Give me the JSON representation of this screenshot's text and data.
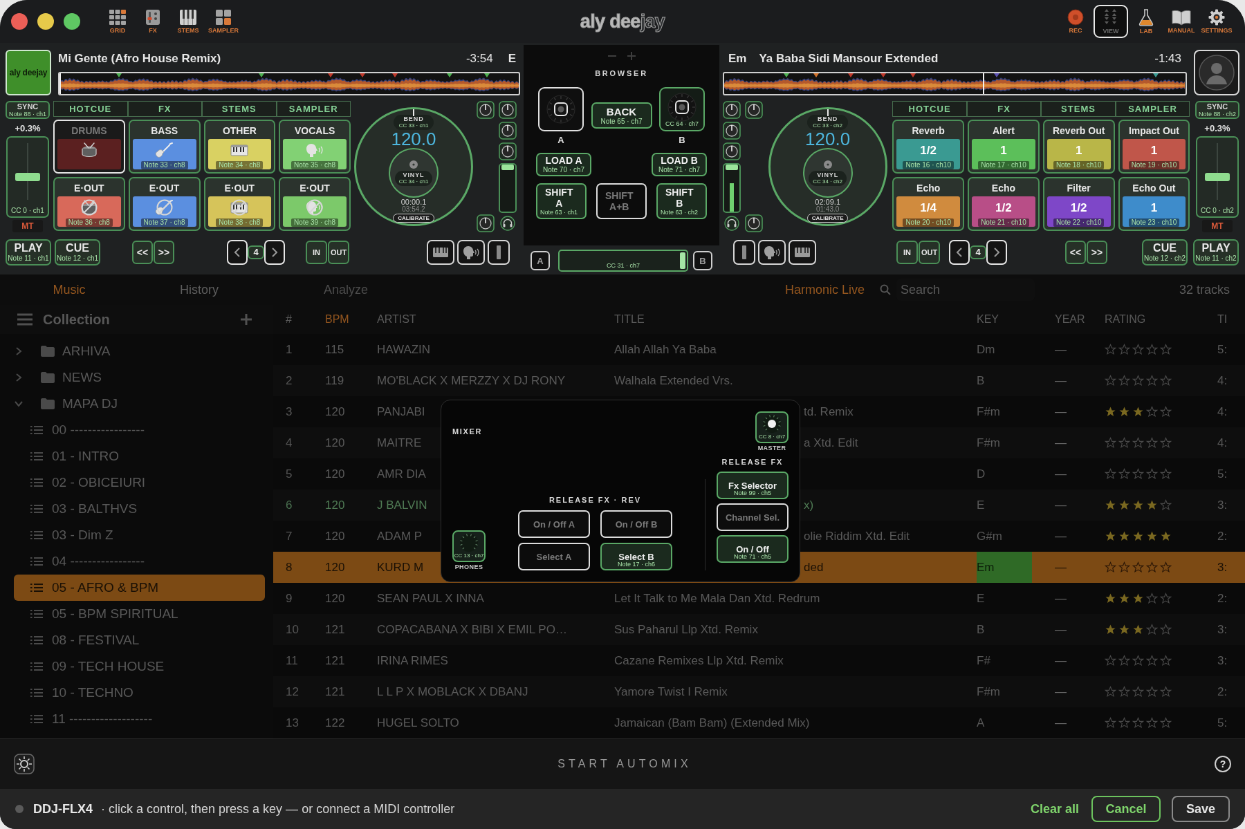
{
  "toolbar_left": [
    {
      "kind": "grid",
      "label": "GRID"
    },
    {
      "kind": "fx",
      "label": "FX"
    },
    {
      "kind": "stems",
      "label": "STEMS"
    },
    {
      "kind": "sampler",
      "label": "SAMPLER"
    }
  ],
  "logo": "**aly dee**jay",
  "toolbar_right": [
    {
      "kind": "rec",
      "label": "REC",
      "selected": false
    },
    {
      "kind": "view",
      "label": "VIEW",
      "selected": true
    },
    {
      "kind": "lab",
      "label": "LAB",
      "selected": false
    },
    {
      "kind": "manual",
      "label": "MANUAL",
      "selected": false
    },
    {
      "kind": "settings",
      "label": "SETTINGS",
      "selected": false
    }
  ],
  "decks": [
    {
      "artwork": {
        "kind": "logo",
        "text": "aly deejay"
      },
      "title": "Mi Gente (Afro House Remix)",
      "remaining": "-3:54",
      "key": "E",
      "playhead": {
        "level": 0
      },
      "sync": {
        "label": "SYNC",
        "note": "Note 88 · ch1"
      },
      "pitch": "+0.3%",
      "pitch_fader": {
        "level": 0.5,
        "note": "CC 0 · ch1"
      },
      "mt": "MT",
      "pad_tabs": [
        "HOTCUE",
        "FX",
        "STEMS",
        "SAMPLER"
      ],
      "pads": [
        {
          "kind": "drums",
          "label": "DRUMS",
          "color": "#5b2020",
          "muted": true,
          "crossed": false
        },
        {
          "kind": "bass",
          "label": "BASS",
          "color": "#5b8fe0",
          "muted": false,
          "crossed": false,
          "note": "Note 33 · ch8"
        },
        {
          "kind": "other",
          "label": "OTHER",
          "color": "#d9d162",
          "muted": false,
          "crossed": false,
          "note": "Note 34 · ch8"
        },
        {
          "kind": "vocals",
          "label": "VOCALS",
          "color": "#82d174",
          "muted": false,
          "crossed": false,
          "note": "Note 35 · ch8"
        },
        {
          "kind": "drums",
          "label": "E·OUT",
          "color": "#d8695a",
          "muted": false,
          "crossed": true,
          "note": "Note 36 · ch8"
        },
        {
          "kind": "bass",
          "label": "E·OUT",
          "color": "#5b8fe0",
          "muted": false,
          "crossed": true,
          "note": "Note 37 · ch8"
        },
        {
          "kind": "other",
          "label": "E·OUT",
          "color": "#d6c45a",
          "muted": false,
          "crossed": true,
          "note": "Note 38 · ch8"
        },
        {
          "kind": "vocals",
          "label": "E·OUT",
          "color": "#7cc96a",
          "muted": false,
          "crossed": true,
          "note": "Note 39 · ch8"
        }
      ],
      "jog": {
        "bend": "BEND",
        "bend_note": "CC 33 · ch1",
        "bpm": "120.0",
        "vinyl": "VINYL",
        "vinyl_note": "CC 34 · ch1",
        "elapsed": "00:00.1",
        "total": "03:54.2",
        "calibrate": "CALIBRATE"
      },
      "volume": {
        "level": 0.95
      },
      "transport": [
        {
          "label": "PLAY",
          "note": "Note 11 · ch1"
        },
        {
          "label": "CUE",
          "note": "Note 12 · ch1"
        }
      ],
      "seek": [
        {
          "label": "<<"
        },
        {
          "label": ">>"
        }
      ],
      "loop": {
        "value": "4"
      },
      "in_out": [
        {
          "label": "IN"
        },
        {
          "label": "OUT"
        }
      ]
    },
    {
      "key": "Em",
      "title": "Ya Baba Sidi Mansour Extended",
      "remaining": "-1:43",
      "artwork": {
        "kind": "avatar"
      },
      "playhead": {
        "level": 0.56
      },
      "volume": {
        "level": 0.95
      },
      "meter": {
        "level": 0.6
      },
      "jog": {
        "bend": "BEND",
        "bend_note": "CC 33 · ch2",
        "bpm": "120.0",
        "vinyl": "VINYL",
        "vinyl_note": "CC 34 · ch2",
        "elapsed": "02:09.1",
        "total": "01:43.0",
        "calibrate": "CALIBRATE"
      },
      "pad_tabs": [
        "HOTCUE",
        "FX",
        "STEMS",
        "SAMPLER"
      ],
      "pads": [
        {
          "kind": "value",
          "label": "Reverb",
          "color": "#3a9a92",
          "value": "1/2",
          "muted": false,
          "note": "Note 16 · ch10"
        },
        {
          "kind": "value",
          "label": "Alert",
          "color": "#5cbf5a",
          "value": "1",
          "muted": false,
          "note": "Note 17 · ch10"
        },
        {
          "kind": "value",
          "label": "Reverb Out",
          "color": "#b9b648",
          "value": "1",
          "muted": false,
          "note": "Note 18 · ch10"
        },
        {
          "kind": "value",
          "label": "Impact Out",
          "color": "#c0564a",
          "value": "1",
          "muted": false,
          "note": "Note 19 · ch10"
        },
        {
          "kind": "value",
          "label": "Echo",
          "color": "#d08b3e",
          "value": "1/4",
          "muted": false,
          "note": "Note 20 · ch10"
        },
        {
          "kind": "value",
          "label": "Echo",
          "color": "#b84e87",
          "value": "1/2",
          "muted": false,
          "note": "Note 21 · ch10"
        },
        {
          "kind": "value",
          "label": "Filter",
          "color": "#7e47c8",
          "value": "1/2",
          "muted": false,
          "note": "Note 22 · ch10"
        },
        {
          "kind": "value",
          "label": "Echo Out",
          "color": "#3e8ccb",
          "value": "1",
          "muted": false,
          "note": "Note 23 · ch10"
        }
      ],
      "sync": {
        "label": "SYNC",
        "note": "Note 88 · ch2"
      },
      "pitch": "+0.3%",
      "pitch_fader": {
        "level": 0.5,
        "note": "CC 0 · ch2"
      },
      "mt": "MT",
      "in_out": [
        {
          "label": "IN"
        },
        {
          "label": "OUT"
        }
      ],
      "loop": {
        "value": "4"
      },
      "seek": [
        {
          "label": "<<"
        },
        {
          "label": ">>"
        }
      ],
      "transport": [
        {
          "label": "CUE",
          "note": "Note 12 · ch2"
        },
        {
          "label": "PLAY",
          "note": "Note 11 · ch2"
        }
      ]
    }
  ],
  "browser": {
    "title": "BROWSER",
    "knobs": [
      {
        "label": "A",
        "mapped": false
      },
      {
        "label": "B",
        "mapped": true,
        "note": "CC 64 · ch7"
      }
    ],
    "back": {
      "label": "BACK",
      "note": "Note 65 · ch7",
      "mapped": true
    },
    "load": [
      {
        "label": "LOAD A",
        "note": "Note 70 · ch7",
        "mapped": true
      },
      {
        "label": "LOAD B",
        "note": "Note 71 · ch7",
        "mapped": true
      }
    ],
    "shift": [
      {
        "label": "SHIFT A",
        "note": "Note 63 · ch1",
        "mapped": true
      },
      {
        "label": "SHIFT A+B",
        "mapped": false
      },
      {
        "label": "SHIFT B",
        "note": "Note 63 · ch2",
        "mapped": true
      }
    ],
    "crossfader": {
      "a": "A",
      "b": "B",
      "level": 0.97,
      "note": "CC 31 · ch7"
    }
  },
  "library": {
    "tabs": [
      {
        "label": "Music",
        "selected": true,
        "disabled": false
      },
      {
        "label": "History",
        "selected": false,
        "disabled": false
      },
      {
        "label": "Analyze",
        "selected": false,
        "disabled": true
      }
    ],
    "harmonic": {
      "label": "Harmonic Live",
      "on": true
    },
    "search": {
      "placeholder": "Search"
    },
    "count": "32 tracks",
    "sidebar": {
      "title": "Collection",
      "items": [
        {
          "kind": "folder",
          "label": "ARHIVA",
          "expanded": false,
          "selected": false
        },
        {
          "kind": "folder",
          "label": "NEWS",
          "expanded": false,
          "selected": false
        },
        {
          "kind": "folder",
          "label": "MAPA DJ",
          "expanded": true,
          "selected": false,
          "children": [
            {
              "kind": "playlist",
              "label": "00 -----------------",
              "selected": false
            },
            {
              "kind": "playlist",
              "label": "01 - INTRO",
              "selected": false
            },
            {
              "kind": "playlist",
              "label": "02 - OBICEIURI",
              "selected": false
            },
            {
              "kind": "playlist",
              "label": "03 - BALTHVS",
              "selected": false
            },
            {
              "kind": "playlist",
              "label": "03 - Dim Z",
              "selected": false
            },
            {
              "kind": "playlist",
              "label": "04 -----------------",
              "selected": false
            },
            {
              "kind": "playlist",
              "label": "05 - AFRO & BPM",
              "selected": true
            },
            {
              "kind": "playlist",
              "label": "05 - BPM SPIRITUAL",
              "selected": false
            },
            {
              "kind": "playlist",
              "label": "08 - FESTIVAL",
              "selected": false
            },
            {
              "kind": "playlist",
              "label": "09 - TECH HOUSE",
              "selected": false
            },
            {
              "kind": "playlist",
              "label": "10 - TECHNO",
              "selected": false
            },
            {
              "kind": "playlist",
              "label": "11 -------------------",
              "selected": false
            }
          ]
        }
      ]
    },
    "table": {
      "columns": [
        {
          "label": "#",
          "sorted": false
        },
        {
          "label": "BPM",
          "sorted": true
        },
        {
          "label": "ARTIST",
          "sorted": false
        },
        {
          "label": "TITLE",
          "sorted": false
        },
        {
          "label": "KEY",
          "sorted": false
        },
        {
          "label": "YEAR",
          "sorted": false
        },
        {
          "label": "RATING",
          "sorted": false
        },
        {
          "label": "TI",
          "sorted": false
        }
      ],
      "rows": [
        {
          "number": "1",
          "bpm": "115",
          "artist": "HAWAZIN",
          "title": "Allah Allah Ya Baba",
          "key": "Dm",
          "year": "—",
          "stars": 0,
          "time": "5:",
          "selected": false,
          "playing": false,
          "key_match": false
        },
        {
          "number": "2",
          "bpm": "119",
          "artist": "MO'BLACK X MERZZY X DJ RONY",
          "title": "Walhala Extended Vrs.",
          "key": "B",
          "year": "—",
          "stars": 0,
          "time": "4:",
          "selected": false,
          "playing": false,
          "key_match": false
        },
        {
          "number": "3",
          "bpm": "120",
          "artist": "PANJABI",
          "title": "td. Remix",
          "key": "F#m",
          "year": "—",
          "stars": 3,
          "time": "4:",
          "selected": false,
          "playing": false,
          "key_match": false
        },
        {
          "number": "4",
          "bpm": "120",
          "artist": "MAITRE",
          "title": "a Xtd. Edit",
          "key": "F#m",
          "year": "—",
          "stars": 0,
          "time": "4:",
          "selected": false,
          "playing": false,
          "key_match": false
        },
        {
          "number": "5",
          "bpm": "120",
          "artist": "AMR DIA",
          "key": "D",
          "year": "—",
          "stars": 0,
          "time": "5:",
          "selected": false,
          "playing": false,
          "key_match": false
        },
        {
          "number": "6",
          "bpm": "120",
          "artist": "J BALVIN",
          "title": "x)",
          "key": "E",
          "year": "—",
          "stars": 4,
          "time": "3:",
          "selected": false,
          "playing": true,
          "key_match": false
        },
        {
          "number": "7",
          "bpm": "120",
          "artist": "ADAM P",
          "title": "olie Riddim Xtd. Edit",
          "key": "G#m",
          "year": "—",
          "stars": 5,
          "time": "2:",
          "selected": false,
          "playing": false,
          "key_match": false
        },
        {
          "number": "8",
          "bpm": "120",
          "artist": "KURD M",
          "title": "ded",
          "key": "Em",
          "year": "—",
          "stars": 0,
          "time": "3:",
          "selected": true,
          "playing": false,
          "key_match": true
        },
        {
          "number": "9",
          "bpm": "120",
          "artist": "SEAN PAUL X INNA",
          "title": "Let It Talk to Me Mala Dan Xtd. Redrum",
          "key": "E",
          "year": "—",
          "stars": 3,
          "time": "2:",
          "selected": false,
          "playing": false,
          "key_match": false
        },
        {
          "number": "10",
          "bpm": "121",
          "artist": "COPACABANA X BIBI X EMIL PO…",
          "title": "Sus Paharul Llp Xtd. Remix",
          "key": "B",
          "year": "—",
          "stars": 3,
          "time": "3:",
          "selected": false,
          "playing": false,
          "key_match": false
        },
        {
          "number": "11",
          "bpm": "121",
          "artist": "IRINA RIMES",
          "title": "Cazane Remixes Llp Xtd. Remix",
          "key": "F#",
          "year": "—",
          "stars": 0,
          "time": "3:",
          "selected": false,
          "playing": false,
          "key_match": false
        },
        {
          "number": "12",
          "bpm": "121",
          "artist": "L L P X MOBLACK X DBANJ",
          "title": "Yamore Twist I Remix",
          "key": "F#m",
          "year": "—",
          "stars": 0,
          "time": "2:",
          "selected": false,
          "playing": false,
          "key_match": false
        },
        {
          "number": "13",
          "bpm": "122",
          "artist": "HUGEL SOLTO",
          "title": "Jamaican (Bam Bam) (Extended Mix)",
          "key": "A",
          "year": "—",
          "stars": 0,
          "time": "5:",
          "selected": false,
          "playing": false,
          "key_match": false
        }
      ]
    }
  },
  "mixer": {
    "title": "MIXER",
    "phones": {
      "label": "PHONES",
      "note": "CC 13 · ch7",
      "active": false
    },
    "master": {
      "label": "MASTER",
      "note": "CC 8 · ch7",
      "active": true
    },
    "rev": {
      "title": "RELEASE FX · REV",
      "buttons": [
        {
          "label": "On / Off A",
          "mapped": false
        },
        {
          "label": "On / Off B",
          "mapped": false
        },
        {
          "label": "Select A",
          "mapped": false
        },
        {
          "label": "Select B",
          "mapped": true,
          "note": "Note 17 · ch6"
        }
      ]
    },
    "release": {
      "title": "RELEASE FX",
      "buttons": [
        {
          "label": "Fx Selector",
          "mapped": true,
          "note": "Note 99 · ch5"
        },
        {
          "label": "Channel Sel.",
          "mapped": false
        },
        {
          "label": "On / Off",
          "mapped": true,
          "note": "Note 71 · ch5"
        }
      ]
    }
  },
  "automix": {
    "label": "START AUTOMIX",
    "help": "?"
  },
  "status_bar": {
    "device": "DDJ-FLX4",
    "connected": false,
    "message": "· click a control, then press a key — or connect a MIDI controller",
    "buttons": [
      {
        "kind": "link",
        "label": "Clear all"
      },
      {
        "kind": "primary",
        "label": "Cancel"
      },
      {
        "kind": "secondary",
        "label": "Save"
      }
    ]
  }
}
